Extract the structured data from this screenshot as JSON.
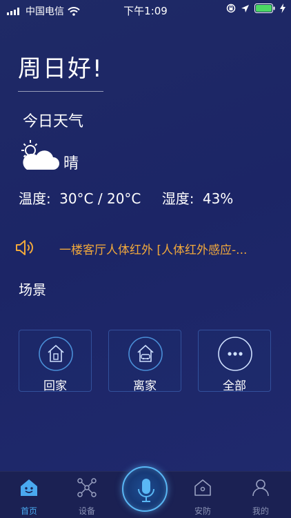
{
  "status_bar": {
    "carrier": "中国电信",
    "time": "下午1:09",
    "icons": [
      "signal-icon",
      "wifi-icon",
      "orientation-lock-icon",
      "location-arrow-icon",
      "battery-icon",
      "charging-icon"
    ],
    "battery_color": "#4cd964"
  },
  "greeting": "周日好!",
  "weather": {
    "title": "今日天气",
    "icon": "partly-cloudy-icon",
    "condition": "晴",
    "temperature_label": "温度:",
    "temperature_value": "30°C / 20°C",
    "humidity_label": "湿度:",
    "humidity_value": "43%"
  },
  "notice": {
    "icon": "speaker-icon",
    "text": "一楼客厅人体红外 [人体红外感应-...",
    "color": "#f2a93b"
  },
  "scenes": {
    "title": "场景",
    "items": [
      {
        "label": "回家",
        "icon": "home-arrive-icon"
      },
      {
        "label": "离家",
        "icon": "home-leave-icon"
      },
      {
        "label": "全部",
        "icon": "more-icon"
      }
    ]
  },
  "tabbar": {
    "active_color": "#4aa9f0",
    "items": [
      {
        "label": "首页",
        "icon": "home-face-icon",
        "active": true
      },
      {
        "label": "设备",
        "icon": "devices-icon",
        "active": false
      },
      {
        "label": "",
        "icon": "microphone-icon",
        "active": false
      },
      {
        "label": "安防",
        "icon": "security-house-icon",
        "active": false
      },
      {
        "label": "我的",
        "icon": "profile-icon",
        "active": false
      }
    ]
  }
}
